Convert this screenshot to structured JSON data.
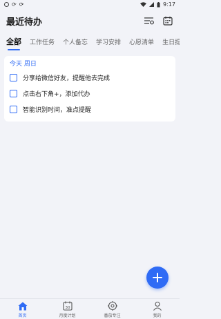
{
  "status_bar": {
    "time": "9:17"
  },
  "header": {
    "title": "最近待办"
  },
  "tabs": [
    {
      "label": "全部",
      "active": true
    },
    {
      "label": "工作任务"
    },
    {
      "label": "个人备忘"
    },
    {
      "label": "学习安排"
    },
    {
      "label": "心愿清单"
    },
    {
      "label": "生日提"
    }
  ],
  "card": {
    "date": "今天 周日",
    "items": [
      {
        "text": "分享给微信好友，提醒他去完成"
      },
      {
        "text": "点击右下角+，添加代办"
      },
      {
        "text": "智能识别时间，准点提醒"
      }
    ]
  },
  "bottom_nav": [
    {
      "label": "首页",
      "icon": "home-icon",
      "active": true
    },
    {
      "label": "月度计划",
      "icon": "calendar-30-icon",
      "day": "30"
    },
    {
      "label": "番茄专注",
      "icon": "focus-target-icon"
    },
    {
      "label": "我的",
      "icon": "profile-icon"
    }
  ],
  "colors": {
    "accent": "#2f6bf5",
    "background": "#f2f3f8",
    "card": "#ffffff"
  }
}
